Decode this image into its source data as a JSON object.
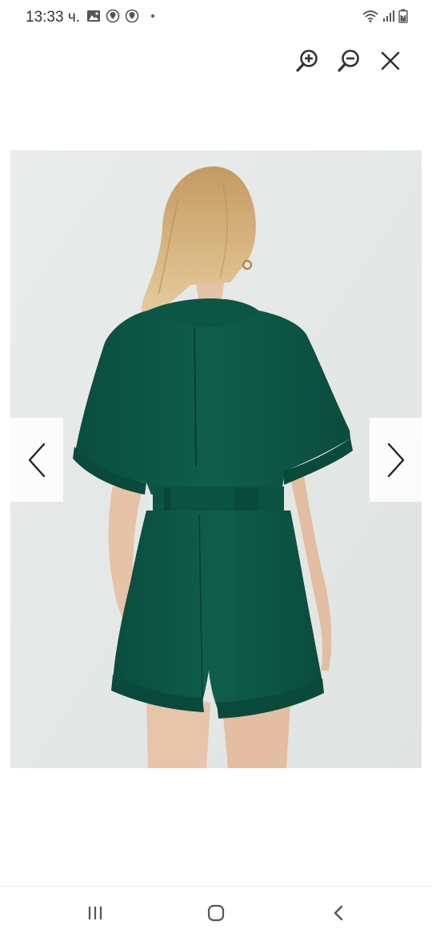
{
  "status_bar": {
    "time": "13:33 ч.",
    "left_icons": [
      "gallery-icon",
      "location-pin-icon",
      "location-pin-icon",
      "dot-icon"
    ],
    "right_icons": [
      "wifi-icon",
      "signal-icon",
      "battery-icon"
    ]
  },
  "toolbar": {
    "zoom_in_icon": "zoom-in-icon",
    "zoom_out_icon": "zoom-out-icon",
    "close_icon": "close-icon"
  },
  "photo": {
    "subject": "product-photo",
    "garment_color": "#0e5a49",
    "background_color": "#e6e9e8"
  },
  "navigation": {
    "prev_icon": "chevron-left-icon",
    "next_icon": "chevron-right-icon"
  },
  "system_nav": {
    "recents_icon": "recents-icon",
    "home_icon": "home-icon",
    "back_icon": "back-icon"
  }
}
